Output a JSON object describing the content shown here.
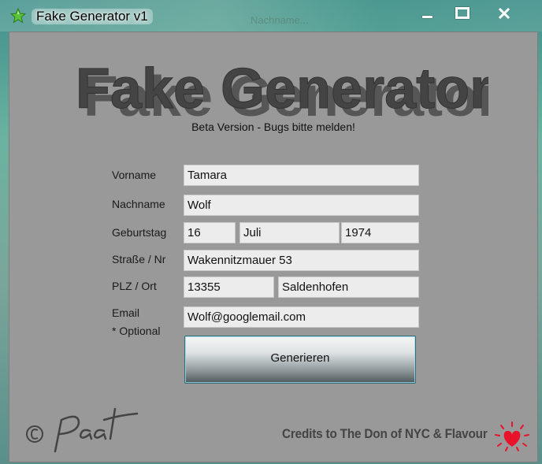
{
  "window": {
    "title": "Fake Generator v1",
    "background_ghost_text": "Nachname..."
  },
  "header": {
    "logo_text": "Fake Generator",
    "subtitle": "Beta Version - Bugs bitte melden!"
  },
  "form": {
    "vorname": {
      "label": "Vorname",
      "value": "Tamara"
    },
    "nachname": {
      "label": "Nachname",
      "value": "Wolf"
    },
    "geburtstag": {
      "label": "Geburtstag",
      "day": "16",
      "month": "Juli",
      "year": "1974"
    },
    "strasse": {
      "label": "Straße / Nr",
      "value": "Wakennitzmauer 53"
    },
    "plz_ort": {
      "label": "PLZ / Ort",
      "plz": "13355",
      "ort": "Saldenhofen"
    },
    "email": {
      "label": "Email",
      "sublabel": "* Optional",
      "value": "Wolf@googlemail.com"
    },
    "generate_label": "Generieren"
  },
  "footer": {
    "signature_text": "© Paat",
    "credits": "Credits to The Don of NYC & Flavour"
  },
  "icons": {
    "app": "green-star-icon",
    "minimize": "minimize-icon",
    "maximize": "maximize-icon",
    "close": "close-icon",
    "heart": "heart-icon"
  },
  "colors": {
    "client_background": "#999999",
    "field_background": "#ececec",
    "logo_text": "#444444",
    "heart": "#e8132a"
  }
}
